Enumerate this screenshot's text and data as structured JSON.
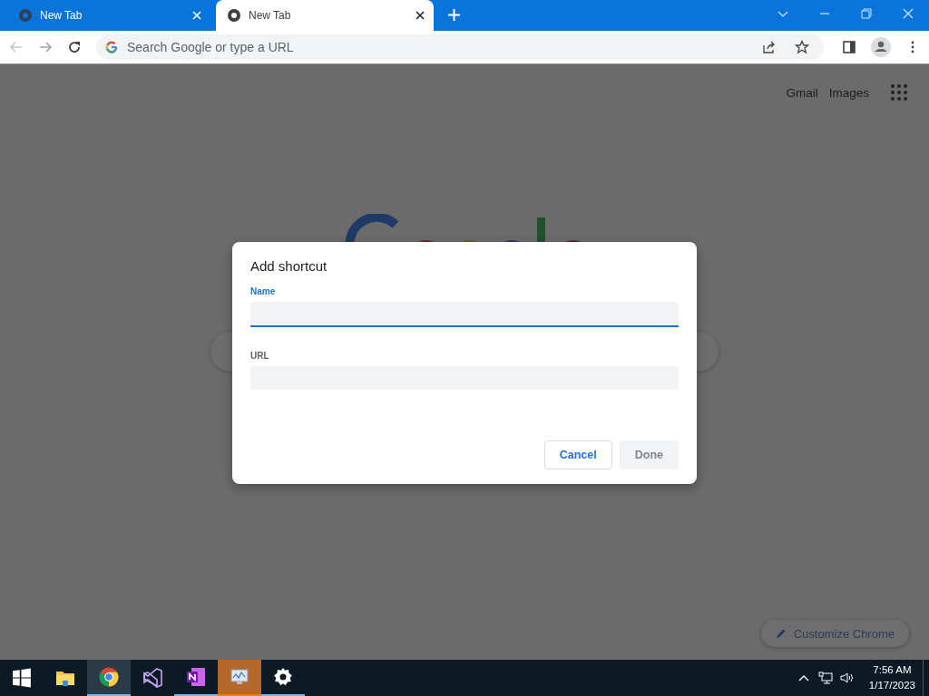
{
  "tabs": [
    {
      "title": "New Tab",
      "selected": false
    },
    {
      "title": "New Tab",
      "selected": true
    }
  ],
  "omnibox": {
    "placeholder": "Search Google or type a URL"
  },
  "header_links": [
    "Gmail",
    "Images"
  ],
  "dialog": {
    "title": "Add shortcut",
    "fields": [
      {
        "label": "Name",
        "focused": true
      },
      {
        "label": "URL",
        "focused": false
      }
    ],
    "buttons": [
      {
        "label": "Cancel",
        "disabled": false
      },
      {
        "label": "Done",
        "disabled": true
      }
    ]
  },
  "customize_button": "Customize Chrome",
  "taskbar": {
    "apps": [
      {
        "kind": "start",
        "running": false,
        "selected": false
      },
      {
        "kind": "explorer",
        "running": false,
        "selected": false
      },
      {
        "kind": "chrome",
        "running": true,
        "selected": true
      },
      {
        "kind": "studio",
        "running": false,
        "selected": false
      },
      {
        "kind": "notes",
        "running": true,
        "selected": false
      },
      {
        "kind": "monitor",
        "running": true,
        "selected": true
      },
      {
        "kind": "settings",
        "running": true,
        "selected": false
      }
    ],
    "time": "7:56 AM",
    "date": "1/17/2023"
  }
}
